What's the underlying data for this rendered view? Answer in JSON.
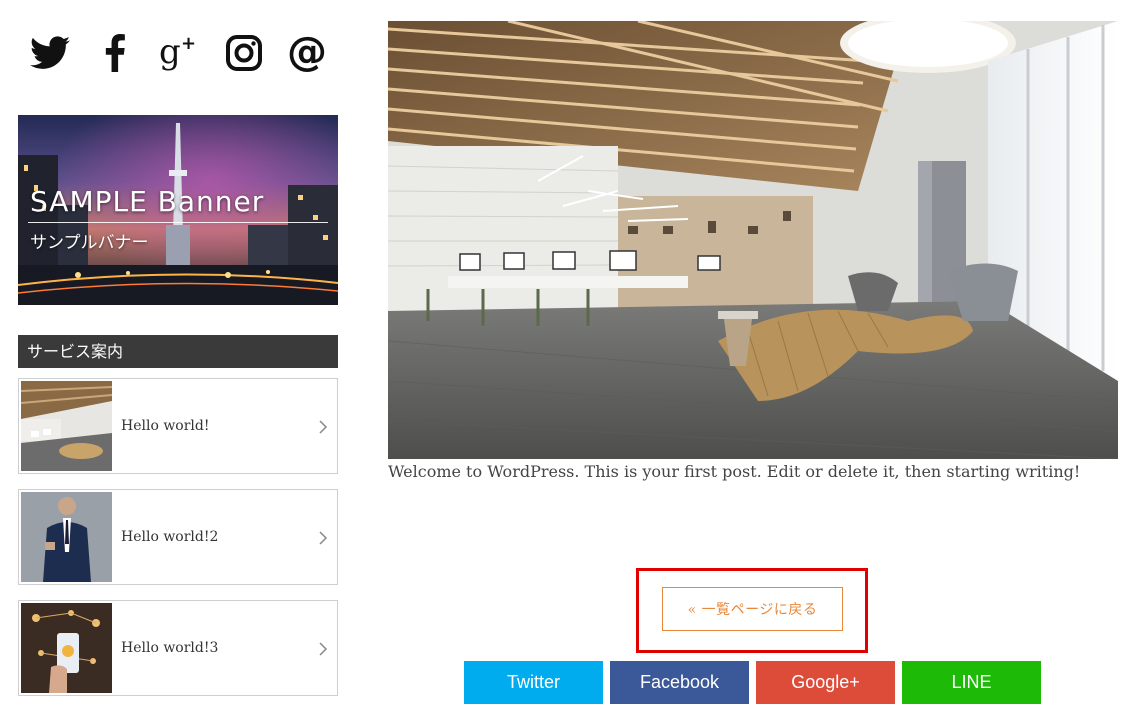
{
  "sidebar": {
    "social_icons": [
      "twitter-icon",
      "facebook-icon",
      "google-plus-icon",
      "instagram-icon",
      "email-at-icon"
    ],
    "banner": {
      "title": "SAMPLE Banner",
      "subtitle": "サンプルバナー"
    },
    "section_title": "サービス案内",
    "posts": [
      {
        "title": "Hello world!"
      },
      {
        "title": "Hello world!2"
      },
      {
        "title": "Hello world!3"
      }
    ]
  },
  "main": {
    "excerpt": "Welcome to WordPress. This is your first post. Edit or delete it, then starting writing!",
    "back_button": "« 一覧ページに戻る"
  },
  "share": {
    "buttons": [
      {
        "label": "Twitter",
        "color": "#00acee"
      },
      {
        "label": "Facebook",
        "color": "#3b5998"
      },
      {
        "label": "Google+",
        "color": "#dd4b39"
      },
      {
        "label": "LINE",
        "color": "#1dba08"
      }
    ]
  },
  "colors": {
    "accent_orange": "#e8883a",
    "highlight_red": "#e00000",
    "section_bar": "#3a3a3a"
  }
}
